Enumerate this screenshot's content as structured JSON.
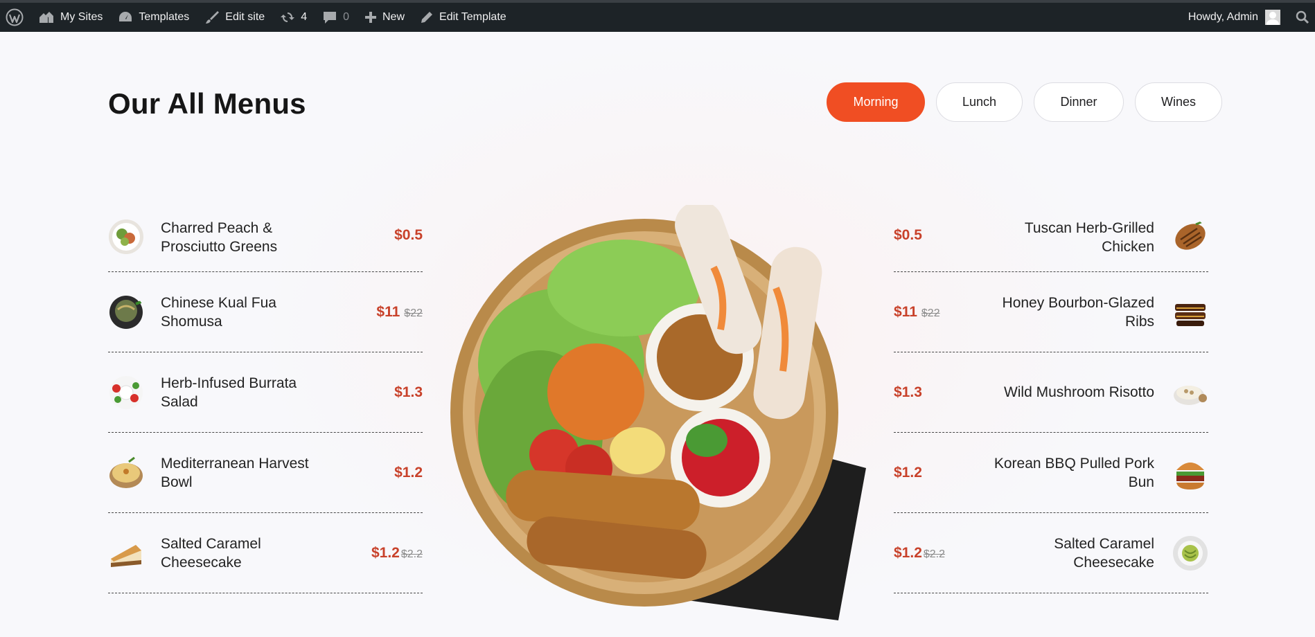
{
  "adminbar": {
    "my_sites": "My Sites",
    "templates": "Templates",
    "edit_site": "Edit site",
    "updates_count": "4",
    "comments_count": "0",
    "new": "New",
    "edit_template": "Edit Template",
    "howdy": "Howdy, Admin"
  },
  "page": {
    "title": "Our All Menus"
  },
  "tabs": [
    {
      "label": "Morning",
      "active": true
    },
    {
      "label": "Lunch",
      "active": false
    },
    {
      "label": "Dinner",
      "active": false
    },
    {
      "label": "Wines",
      "active": false
    }
  ],
  "left_menu": [
    {
      "name": "Charred Peach & Prosciutto Greens",
      "price": "$0.5",
      "old_price": "",
      "icon": "salad-plate-icon"
    },
    {
      "name": "Chinese Kual Fua Shomusa",
      "price": "$11",
      "old_price": "$22",
      "icon": "noodle-bowl-icon"
    },
    {
      "name": "Herb-Infused Burrata Salad",
      "price": "$1.3",
      "old_price": "",
      "icon": "burrata-salad-icon"
    },
    {
      "name": "Mediterranean Harvest Bowl",
      "price": "$1.2",
      "old_price": "",
      "icon": "hummus-bowl-icon"
    },
    {
      "name": "Salted Caramel Cheesecake",
      "price": "$1.2",
      "old_price": "$2.2",
      "icon": "cheesecake-icon"
    }
  ],
  "right_menu": [
    {
      "name": "Tuscan Herb-Grilled Chicken",
      "price": "$0.5",
      "old_price": "",
      "icon": "grilled-chicken-icon"
    },
    {
      "name": "Honey Bourbon-Glazed Ribs",
      "price": "$11",
      "old_price": "$22",
      "icon": "ribs-icon"
    },
    {
      "name": "Wild Mushroom Risotto",
      "price": "$1.3",
      "old_price": "",
      "icon": "risotto-icon"
    },
    {
      "name": "Korean BBQ Pulled Pork Bun",
      "price": "$1.2",
      "old_price": "",
      "icon": "burger-icon"
    },
    {
      "name": "Salted Caramel Cheesecake",
      "price": "$1.2",
      "old_price": "$2.2",
      "icon": "noodle-plate-icon"
    }
  ],
  "colors": {
    "accent": "#f04e23",
    "price": "#c8412a",
    "adminbar_bg": "#1d2327"
  }
}
